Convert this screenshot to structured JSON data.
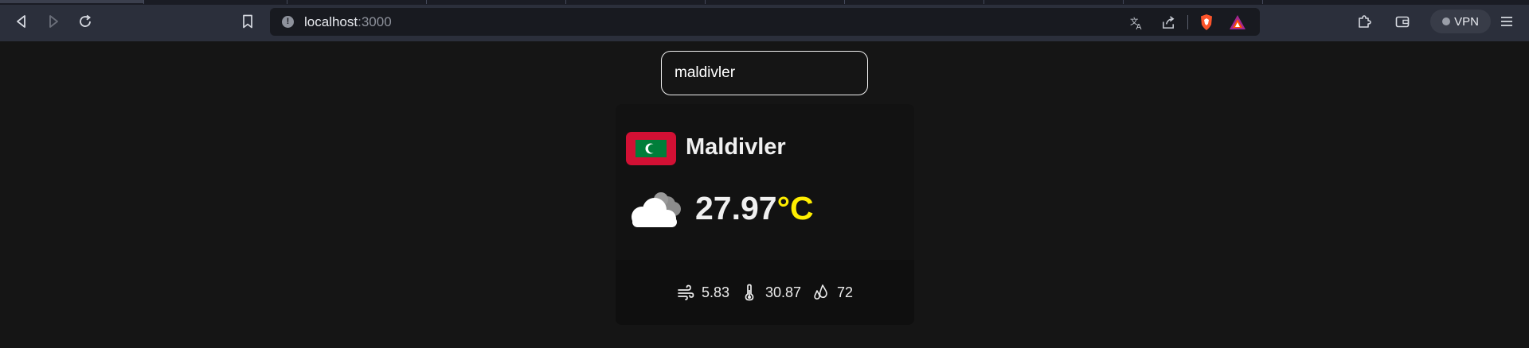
{
  "browser": {
    "url_host": "localhost",
    "url_port": ":3000",
    "vpn_label": "VPN"
  },
  "search": {
    "value": "maldivler"
  },
  "weather": {
    "country": "Maldivler",
    "temperature": "27.97",
    "unit": "°C",
    "wind": "5.83",
    "feels_like": "30.87",
    "humidity": "72"
  },
  "colors": {
    "accent_unit": "#ffee00",
    "flag_red": "#d21034",
    "flag_green": "#007e3a"
  },
  "icons": {
    "condition": "cloud-icon",
    "wind": "wind-icon",
    "feels_like": "thermometer-icon",
    "humidity": "droplets-icon"
  }
}
